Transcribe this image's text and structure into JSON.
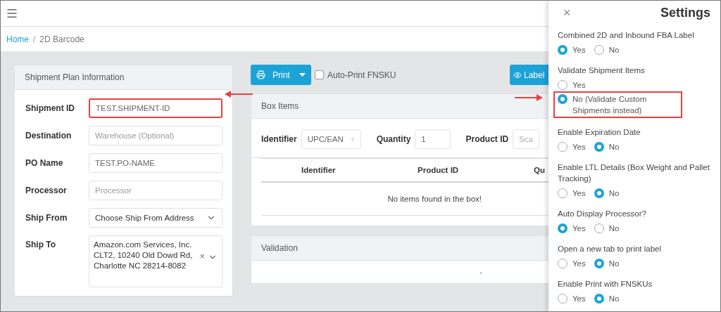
{
  "breadcrumb": [
    {
      "label": "Home",
      "kind": "link"
    },
    {
      "label": "/",
      "kind": "separator"
    },
    {
      "label": "2D Barcode",
      "kind": "current"
    }
  ],
  "shipment_plan": {
    "title": "Shipment Plan Information",
    "fields": [
      {
        "label": "Shipment ID",
        "kind": "input",
        "value": "TEST.SHIPMENT-ID",
        "highlighted": true
      },
      {
        "label": "Destination",
        "kind": "input",
        "placeholder": "Warehouse (Optional)",
        "highlighted": false
      },
      {
        "label": "PO Name",
        "kind": "input",
        "value": "TEST.PO-NAME",
        "highlighted": false
      },
      {
        "label": "Processor",
        "kind": "input",
        "placeholder": "Processor",
        "highlighted": false
      },
      {
        "label": "Ship From",
        "kind": "select",
        "value": "Choose Ship From Address",
        "highlighted": false
      },
      {
        "label": "Ship To",
        "kind": "address",
        "lines": [
          "Amazon.com Services, Inc.",
          "CLT2, 10240 Old Dowd Rd,",
          "Charlotte NC 28214-8082"
        ],
        "clear": "×",
        "highlighted": false
      }
    ]
  },
  "toolbar": {
    "print_button": "Print",
    "auto_print": {
      "label": "Auto-Print FNSKU",
      "checked": false
    },
    "label_button": "Label"
  },
  "box_items": {
    "title": "Box Items",
    "filters": [
      {
        "label": "Identifier",
        "kind": "select",
        "value": "UPC/EAN"
      },
      {
        "label": "Quantity",
        "kind": "input",
        "value": "1"
      },
      {
        "label": "Product ID",
        "kind": "input",
        "placeholder": "Sca"
      }
    ],
    "columns": [
      "Identifier",
      "Product ID",
      "Qu"
    ],
    "empty_message": "No items found in the box!"
  },
  "validation": {
    "title": "Validation",
    "value": "-"
  },
  "settings": {
    "title": "Settings",
    "close": "×",
    "groups": [
      {
        "label": "Combined 2D and Inbound FBA Label",
        "kind": "inline",
        "options": [
          {
            "label": "Yes",
            "selected": true,
            "highlighted": false
          },
          {
            "label": "No",
            "selected": false,
            "highlighted": false
          }
        ]
      },
      {
        "label": "Validate Shipment Items",
        "kind": "stacked",
        "options": [
          {
            "label": "Yes",
            "selected": false,
            "highlighted": false
          },
          {
            "label": "No (Validate Custom Shipments instead)",
            "selected": true,
            "highlighted": true
          }
        ]
      },
      {
        "label": "Enable Expiration Date",
        "kind": "inline",
        "options": [
          {
            "label": "Yes",
            "selected": false,
            "highlighted": false
          },
          {
            "label": "No",
            "selected": true,
            "highlighted": false
          }
        ]
      },
      {
        "label": "Enable LTL Details (Box Weight and Pallet Tracking)",
        "kind": "inline",
        "options": [
          {
            "label": "Yes",
            "selected": false,
            "highlighted": false
          },
          {
            "label": "No",
            "selected": true,
            "highlighted": false
          }
        ]
      },
      {
        "label": "Auto Display Processor?",
        "kind": "inline",
        "options": [
          {
            "label": "Yes",
            "selected": true,
            "highlighted": false
          },
          {
            "label": "No",
            "selected": false,
            "highlighted": false
          }
        ]
      },
      {
        "label": "Open a new tab to print label",
        "kind": "inline",
        "options": [
          {
            "label": "Yes",
            "selected": false,
            "highlighted": false
          },
          {
            "label": "No",
            "selected": true,
            "highlighted": false
          }
        ]
      },
      {
        "label": "Enable Print with FNSKUs",
        "kind": "inline",
        "options": [
          {
            "label": "Yes",
            "selected": false,
            "highlighted": false
          },
          {
            "label": "No",
            "selected": true,
            "highlighted": false
          }
        ]
      }
    ]
  }
}
